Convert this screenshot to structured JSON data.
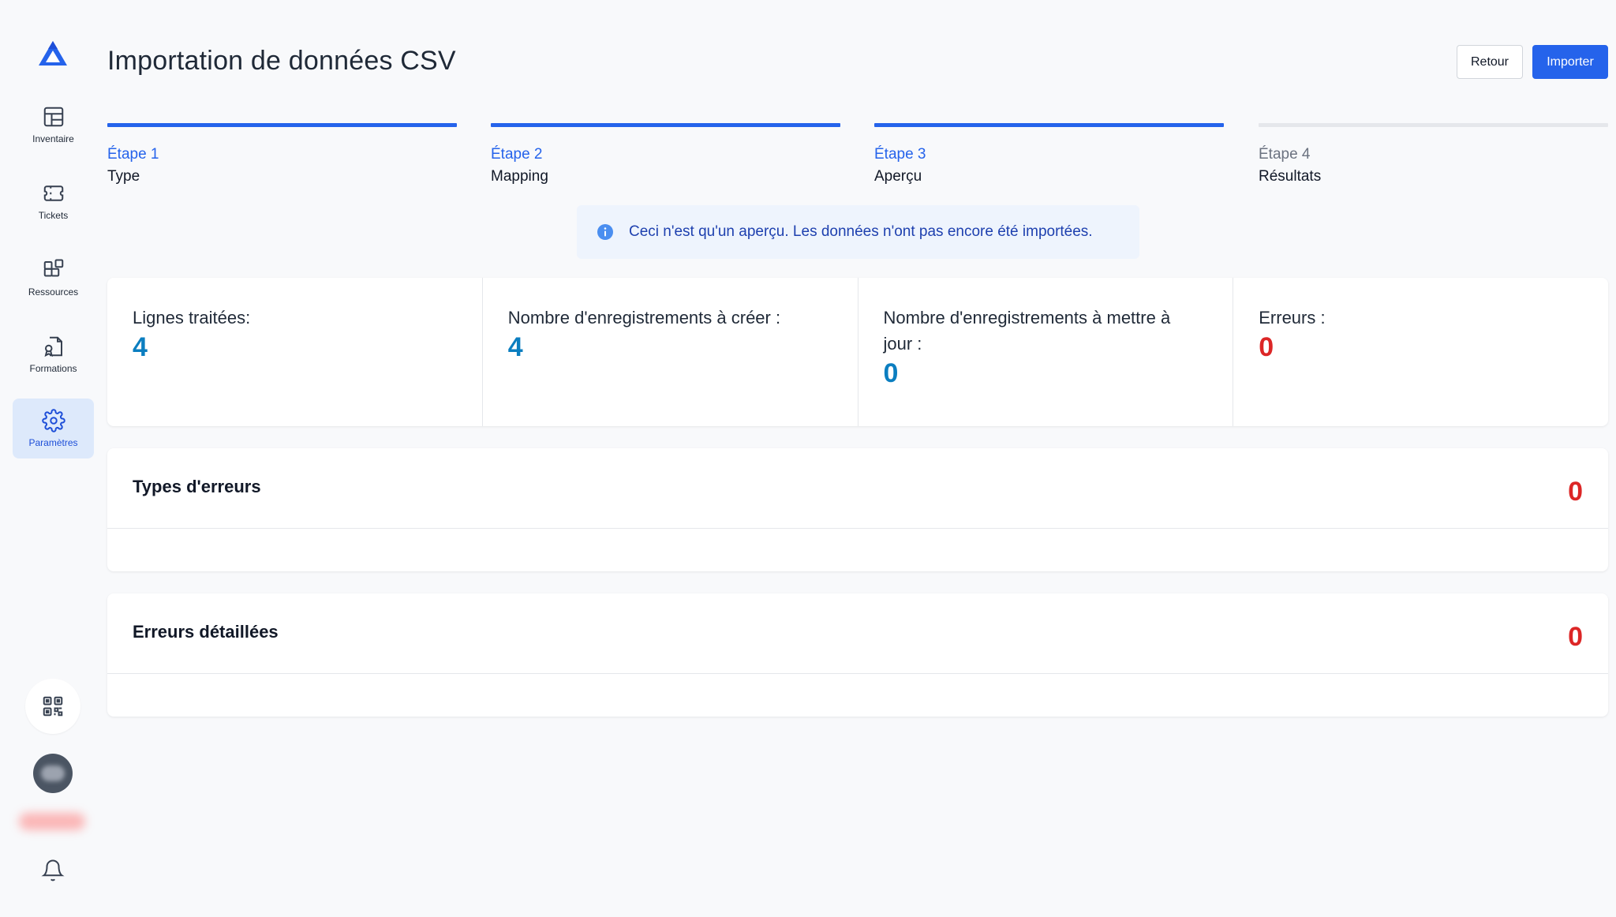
{
  "header": {
    "title": "Importation de données CSV",
    "back_label": "Retour",
    "import_label": "Importer"
  },
  "sidebar": {
    "items": [
      {
        "label": "Inventaire",
        "icon": "grid-table-icon"
      },
      {
        "label": "Tickets",
        "icon": "ticket-icon"
      },
      {
        "label": "Ressources",
        "icon": "resources-icon"
      },
      {
        "label": "Formations",
        "icon": "certificate-icon"
      },
      {
        "label": "Paramètres",
        "icon": "gear-icon",
        "active": true
      }
    ],
    "bottom": [
      "qr-code-icon",
      "avatar",
      "bell-icon"
    ]
  },
  "steps": [
    {
      "number": "Étape 1",
      "name": "Type",
      "status": "done"
    },
    {
      "number": "Étape 2",
      "name": "Mapping",
      "status": "done"
    },
    {
      "number": "Étape 3",
      "name": "Aperçu",
      "status": "current"
    },
    {
      "number": "Étape 4",
      "name": "Résultats",
      "status": "pending"
    }
  ],
  "info": {
    "text": "Ceci n'est qu'un aperçu. Les données n'ont pas encore été importées."
  },
  "stats": [
    {
      "label": "Lignes traitées:",
      "value": "4",
      "color": "#0b7ec0"
    },
    {
      "label": "Nombre d'enregistrements à créer :",
      "value": "4",
      "color": "#0b7ec0"
    },
    {
      "label": "Nombre d'enregistrements à mettre à jour :",
      "value": "0",
      "color": "#0b7ec0"
    },
    {
      "label": "Erreurs :",
      "value": "0",
      "color": "#dc2626"
    }
  ],
  "panels": [
    {
      "title": "Types d'erreurs",
      "count": "0"
    },
    {
      "title": "Erreurs détaillées",
      "count": "0"
    }
  ],
  "colors": {
    "accent": "#2563eb",
    "error": "#dc2626",
    "stat_value": "#0b7ec0"
  }
}
